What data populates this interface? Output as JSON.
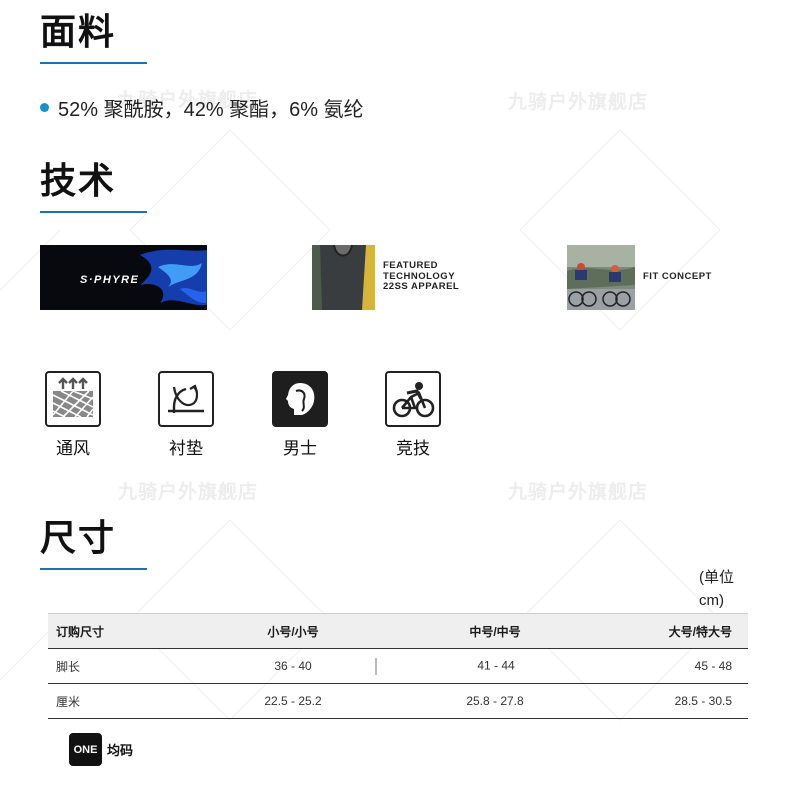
{
  "watermark": "九骑户外旗舰店",
  "fabric": {
    "title": "面料",
    "items": [
      "52% 聚酰胺，42% 聚酯，6% 氨纶"
    ]
  },
  "technology": {
    "title": "技术",
    "cards": [
      {
        "logo_text": "S·PHYRE",
        "caption_lines": []
      },
      {
        "logo_text": "",
        "caption_lines": [
          "FEATURED",
          "TECHNOLOGY",
          "22SS APPAREL"
        ]
      },
      {
        "logo_text": "",
        "caption_lines": [
          "FIT CONCEPT"
        ]
      }
    ],
    "features": [
      {
        "label": "通风",
        "icon": "ventilation-icon"
      },
      {
        "label": "衬垫",
        "icon": "padding-icon"
      },
      {
        "label": "男士",
        "icon": "men-head-icon"
      },
      {
        "label": "竞技",
        "icon": "racing-cyclist-icon"
      }
    ]
  },
  "size": {
    "title": "尺寸",
    "unit_line1": "(单位",
    "unit_line2": "cm)",
    "headers": [
      "订购尺寸",
      "小号/小号",
      "中号/中号",
      "大号/特大号"
    ],
    "rows": [
      [
        "脚长",
        "36 - 40",
        "41 - 44",
        "45 - 48"
      ],
      [
        "厘米",
        "22.5 - 25.2",
        "25.8 - 27.8",
        "28.5 - 30.5"
      ]
    ],
    "one_badge": "ONE",
    "one_label": "均码"
  },
  "colors": {
    "accent": "#1a73b8",
    "bullet": "#1a8fd0",
    "header_bg": "#efefef"
  }
}
